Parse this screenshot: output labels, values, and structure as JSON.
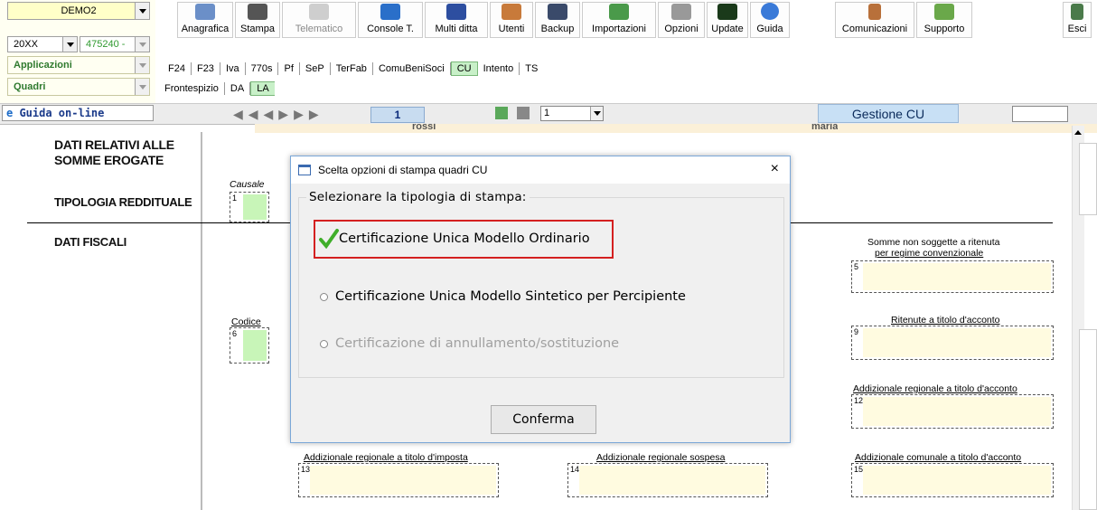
{
  "selectors": {
    "company": "DEMO2",
    "year": "20XX",
    "code": "475240 -",
    "applicazioni": "Applicazioni",
    "quadri": "Quadri"
  },
  "toolbar": {
    "items": [
      "Anagrafica",
      "Stampa",
      "Telematico",
      "Console T.",
      "Multi ditta",
      "Utenti",
      "Backup",
      "Importazioni",
      "Opzioni",
      "Update",
      "Guida"
    ],
    "right": [
      "Comunicazioni",
      "Supporto"
    ],
    "exit": "Esci"
  },
  "nav": {
    "apps": [
      "F24",
      "F23",
      "Iva",
      "770s",
      "Pf",
      "SeP",
      "TerFab",
      "ComuBeniSoci",
      "CU",
      "Intento",
      "TS"
    ],
    "active_app": "CU",
    "quadri": [
      "Frontespizio",
      "DA",
      "LA"
    ],
    "active_quadro": "LA"
  },
  "statusbar": {
    "guida": "Guida on-line",
    "page": "1",
    "copy": "1",
    "section": "Gestione CU",
    "behind_left": "rossi",
    "behind_right": "maria"
  },
  "form": {
    "h1": "DATI RELATIVI ALLE",
    "h2": "SOMME EROGATE",
    "h3": "TIPOLOGIA REDDITUALE",
    "h4": "DATI FISCALI",
    "causale_label": "Causale",
    "causale_num": "1",
    "codice_label": "Codice",
    "codice_num": "6",
    "f5_label_1": "Somme non soggette a ritenuta",
    "f5_label_2": "per regime convenzionale",
    "f5_num": "5",
    "f9_label": "Ritenute a titolo d'acconto",
    "f9_num": "9",
    "f12_label": "Addizionale regionale a titolo d'acconto",
    "f12_num": "12",
    "f13_label": "Addizionale regionale a titolo d'imposta",
    "f13_num": "13",
    "f14_label": "Addizionale regionale sospesa",
    "f14_num": "14",
    "f15_label": "Addizionale comunale a titolo d'acconto",
    "f15_num": "15"
  },
  "dialog": {
    "title": "Scelta opzioni di stampa quadri CU",
    "group_label": "Selezionare la tipologia di stampa:",
    "opt1": "Certificazione Unica Modello Ordinario",
    "opt2": "Certificazione Unica Modello Sintetico per Percipiente",
    "opt3": "Certificazione di annullamento/sostituzione",
    "confirm": "Conferma",
    "close": "×"
  },
  "colors": {
    "highlight": "#d42020",
    "check": "#3fae2a",
    "accent": "#5b9bd5"
  }
}
